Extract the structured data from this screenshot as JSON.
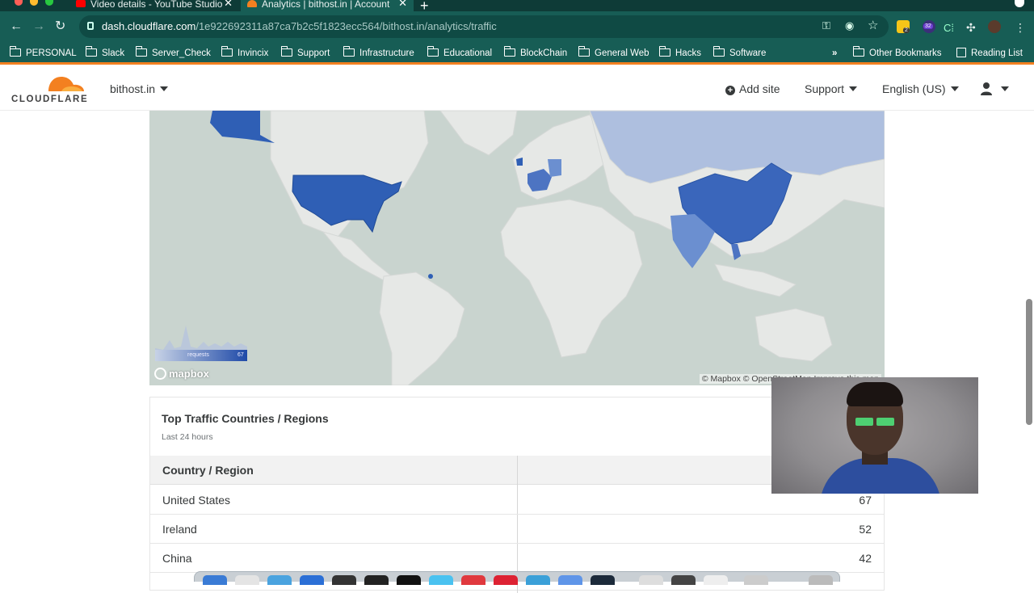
{
  "browser": {
    "tabs": [
      {
        "title": "Video details - YouTube Studio",
        "favicon": "youtube-icon",
        "active": false
      },
      {
        "title": "Analytics | bithost.in | Account",
        "favicon": "cloudflare-icon",
        "active": true
      }
    ],
    "url_domain": "dash.cloudflare.com",
    "url_path": "/1e922692311a87ca7b2c5f1823ecc564/bithost.in/analytics/traffic",
    "extension_badges": {
      "first": "2",
      "second": "32"
    },
    "bookmarks": [
      "PERSONAL",
      "Slack",
      "Server_Check",
      "Invincix",
      "Support",
      "Infrastructure",
      "Educational",
      "BlockChain",
      "General Web",
      "Hacks",
      "Software"
    ],
    "bookmarks_overflow": "»",
    "other_bookmarks": "Other Bookmarks",
    "reading_list": "Reading List"
  },
  "header": {
    "logo_text": "CLOUDFLARE",
    "zone_name": "bithost.in",
    "add_site": "Add site",
    "support": "Support",
    "language": "English (US)"
  },
  "map": {
    "attribution": "© Mapbox © OpenStreetMap Improve this map",
    "mapbox_logo": "mapbox",
    "legend_label": "requests",
    "legend_max": "67",
    "colors": {
      "ocean": "#c9d4cf",
      "land": "#e6e8e6",
      "high": "#2f5fb5",
      "mid": "#6b8fd0",
      "low": "#aebfdf"
    }
  },
  "table": {
    "title": "Top Traffic Countries / Regions",
    "subtitle": "Last 24 hours",
    "column_country": "Country / Region",
    "column_value": "",
    "rows": [
      {
        "country": "United States",
        "value": "67"
      },
      {
        "country": "Ireland",
        "value": "52"
      },
      {
        "country": "China",
        "value": "42"
      }
    ]
  }
}
